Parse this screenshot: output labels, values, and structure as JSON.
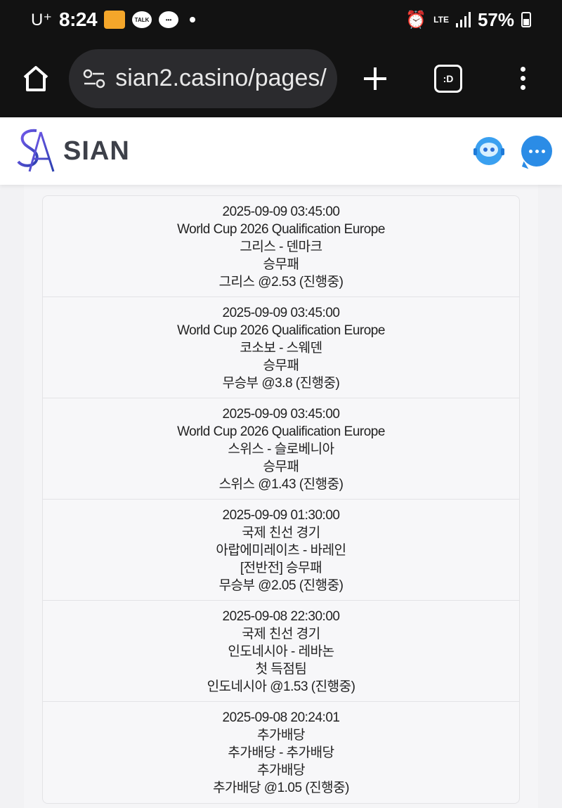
{
  "status_bar": {
    "carrier": "U⁺",
    "time": "8:24",
    "talk_label": "TALK",
    "network": "LTE",
    "battery": "57%"
  },
  "browser": {
    "url": "sian2.casino/pages/"
  },
  "site": {
    "brand": "SIAN",
    "accent": "#2b8ce6"
  },
  "bets": [
    {
      "datetime": "2025-09-09 03:45:00",
      "league": "World Cup 2026 Qualification Europe",
      "match": "그리스 - 덴마크",
      "market": "승무패",
      "pick": "그리스 @2.53 (진행중)"
    },
    {
      "datetime": "2025-09-09 03:45:00",
      "league": "World Cup 2026 Qualification Europe",
      "match": "코소보 - 스웨덴",
      "market": "승무패",
      "pick": "무승부 @3.8 (진행중)"
    },
    {
      "datetime": "2025-09-09 03:45:00",
      "league": "World Cup 2026 Qualification Europe",
      "match": "스위스 - 슬로베니아",
      "market": "승무패",
      "pick": "스위스 @1.43 (진행중)"
    },
    {
      "datetime": "2025-09-09 01:30:00",
      "league": "국제 친선 경기",
      "match": "아랍에미레이츠 - 바레인",
      "market": "[전반전] 승무패",
      "pick": "무승부 @2.05 (진행중)"
    },
    {
      "datetime": "2025-09-08 22:30:00",
      "league": "국제 친선 경기",
      "match": "인도네시아 - 레바논",
      "market": "첫 득점팀",
      "pick": "인도네시아 @1.53 (진행중)"
    },
    {
      "datetime": "2025-09-08 20:24:01",
      "league": "추가배당",
      "match": "추가배당 - 추가배당",
      "market": "추가배당",
      "pick": "추가배당 @1.05 (진행중)"
    }
  ]
}
